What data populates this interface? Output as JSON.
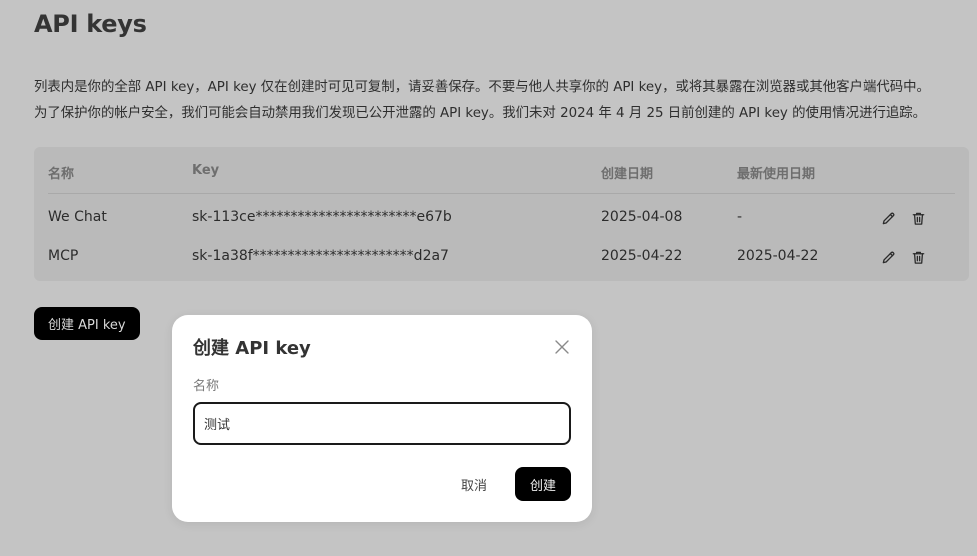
{
  "page": {
    "title": "API keys",
    "description_line1": "列表内是你的全部 API key，API key 仅在创建时可见可复制，请妥善保存。不要与他人共享你的 API key，或将其暴露在浏览器或其他客户端代码中。",
    "description_line2": "为了保护你的帐户安全，我们可能会自动禁用我们发现已公开泄露的 API key。我们未对 2024 年 4 月 25 日前创建的 API key 的使用情况进行追踪。"
  },
  "table": {
    "headers": {
      "name": "名称",
      "key": "Key",
      "created": "创建日期",
      "last_used": "最新使用日期"
    },
    "rows": [
      {
        "name": "We Chat",
        "key": "sk-113ce***********************e67b",
        "created": "2025-04-08",
        "last_used": "-"
      },
      {
        "name": "MCP",
        "key": "sk-1a38f***********************d2a7",
        "created": "2025-04-22",
        "last_used": "2025-04-22"
      }
    ]
  },
  "create_button_label": "创建 API key",
  "modal": {
    "title": "创建 API key",
    "name_label": "名称",
    "name_value": "测试",
    "cancel_label": "取消",
    "confirm_label": "创建"
  },
  "icons": {
    "edit": "pencil-icon",
    "delete": "trash-icon",
    "close": "close-icon"
  },
  "colors": {
    "backdrop": "#c4c4c4",
    "table_bg": "#bababa",
    "primary_button": "#000000",
    "modal_bg": "#ffffff"
  }
}
